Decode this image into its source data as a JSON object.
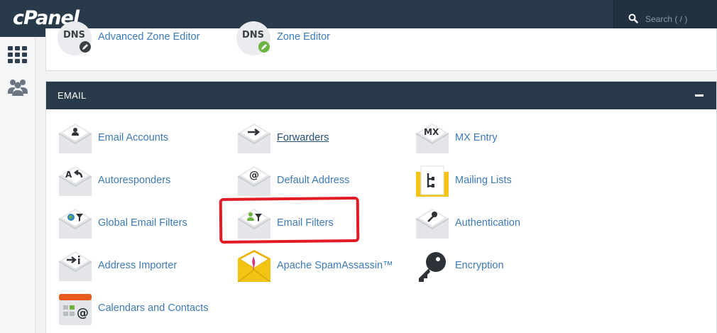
{
  "header": {
    "logo": "cPanel",
    "search_placeholder": "Search ( / )"
  },
  "sidebar": {
    "items": [
      {
        "icon": "grid-icon",
        "label": "Home"
      },
      {
        "icon": "users-icon",
        "label": "User Manager"
      }
    ]
  },
  "domains_section": {
    "items": [
      {
        "label": "Advanced Zone Editor",
        "badge": "DNS"
      },
      {
        "label": "Zone Editor",
        "badge": "DNS"
      }
    ]
  },
  "email_section": {
    "title": "EMAIL",
    "items": [
      {
        "label": "Email Accounts",
        "icon": "email-accounts-icon"
      },
      {
        "label": "Forwarders",
        "icon": "forwarders-icon"
      },
      {
        "label": "MX Entry",
        "icon": "mx-entry-icon",
        "badge": "MX"
      },
      {
        "label": "Autoresponders",
        "icon": "autoresponders-icon"
      },
      {
        "label": "Default Address",
        "icon": "default-address-icon"
      },
      {
        "label": "Mailing Lists",
        "icon": "mailing-lists-icon"
      },
      {
        "label": "Global Email Filters",
        "icon": "global-email-filters-icon"
      },
      {
        "label": "Email Filters",
        "icon": "email-filters-icon"
      },
      {
        "label": "Authentication",
        "icon": "authentication-icon"
      },
      {
        "label": "Address Importer",
        "icon": "address-importer-icon"
      },
      {
        "label": "Apache SpamAssassin™",
        "icon": "spamassassin-icon"
      },
      {
        "label": "Encryption",
        "icon": "encryption-icon"
      },
      {
        "label": "Calendars and Contacts",
        "icon": "calendars-contacts-icon"
      }
    ]
  },
  "colors": {
    "header": "#293a4a",
    "link": "#3d7ab8",
    "annotation": "#e21b24"
  }
}
